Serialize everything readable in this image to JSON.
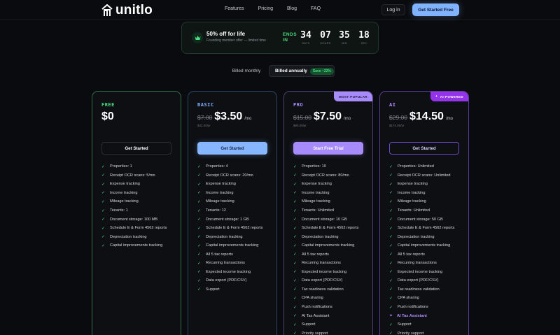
{
  "colors": {
    "background": "#0a0b0e",
    "accent_blue": "#7fb2ff",
    "accent_green": "#4ade80",
    "accent_purple": "#a78bfa"
  },
  "nav": {
    "brand": "unitlo",
    "links": [
      "Features",
      "Pricing",
      "Blog",
      "FAQ"
    ],
    "login": "Log in",
    "cta": "Get Started Free"
  },
  "promo": {
    "title": "50% off for life",
    "subtitle": "Founding member offer — limited time",
    "ends_label": "ENDS IN",
    "countdown": [
      {
        "value": "34",
        "label": "DAYS"
      },
      {
        "value": "07",
        "label": "HOURS"
      },
      {
        "value": "35",
        "label": "MIN"
      },
      {
        "value": "18",
        "label": "SEC"
      }
    ]
  },
  "billing": {
    "monthly": "Billed monthly",
    "annually": "Billed annually",
    "save_badge": "Save ~22%"
  },
  "plans": [
    {
      "name": "FREE",
      "old_price": "",
      "price": "$0",
      "per": "",
      "yearly": "",
      "button": "Get Started",
      "ribbon": "",
      "features": [
        "Properties: 1",
        "Receipt OCR scans: 5/mo",
        "Expense tracking",
        "Income tracking",
        "Mileage tracking",
        "Tenants: 1",
        "Document storage: 100 MB",
        "Schedule E & Form 4562 reports",
        "Depreciation tracking",
        "Capital improvements tracking"
      ]
    },
    {
      "name": "BASIC",
      "old_price": "$7.00",
      "price": "$3.50",
      "per": "/mo",
      "yearly": "$42.00/yr",
      "button": "Get Started",
      "ribbon": "",
      "features": [
        "Properties: 4",
        "Receipt OCR scans: 20/mo",
        "Expense tracking",
        "Income tracking",
        "Mileage tracking",
        "Tenants: 12",
        "Document storage: 1 GB",
        "Schedule E & Form 4562 reports",
        "Depreciation tracking",
        "Capital improvements tracking",
        "All 5 tax reports",
        "Recurring transactions",
        "Expected income tracking",
        "Data export (PDF/CSV)",
        "Support"
      ]
    },
    {
      "name": "PRO",
      "old_price": "$15.00",
      "price": "$7.50",
      "per": "/mo",
      "yearly": "$90.00/yr",
      "button": "Start Free Trial",
      "ribbon": "MOST POPULAR",
      "features": [
        "Properties: 10",
        "Receipt OCR scans: 80/mo",
        "Expense tracking",
        "Income tracking",
        "Mileage tracking",
        "Tenants: Unlimited",
        "Document storage: 10 GB",
        "Schedule E & Form 4562 reports",
        "Depreciation tracking",
        "Capital improvements tracking",
        "All 5 tax reports",
        "Recurring transactions",
        "Expected income tracking",
        "Data export (PDF/CSV)",
        "Tax readiness validation",
        "CPA sharing",
        "Push notifications",
        "AI Tax Assistant",
        "Support",
        "Priority support"
      ]
    },
    {
      "name": "AI",
      "old_price": "$29.00",
      "price": "$14.50",
      "per": "/mo",
      "yearly": "$174.00/yr",
      "button": "Get Started",
      "ribbon": "AI-POWERED",
      "features": [
        "Properties: Unlimited",
        "Receipt OCR scans: Unlimited",
        "Expense tracking",
        "Income tracking",
        "Mileage tracking",
        "Tenants: Unlimited",
        "Document storage: 50 GB",
        "Schedule E & Form 4562 reports",
        "Depreciation tracking",
        "Capital improvements tracking",
        "All 5 tax reports",
        "Recurring transactions",
        "Expected income tracking",
        "Data export (PDF/CSV)",
        "Tax readiness validation",
        "CPA sharing",
        "Push notifications",
        "AI Tax Assistant",
        "Support",
        "Priority support"
      ]
    }
  ]
}
